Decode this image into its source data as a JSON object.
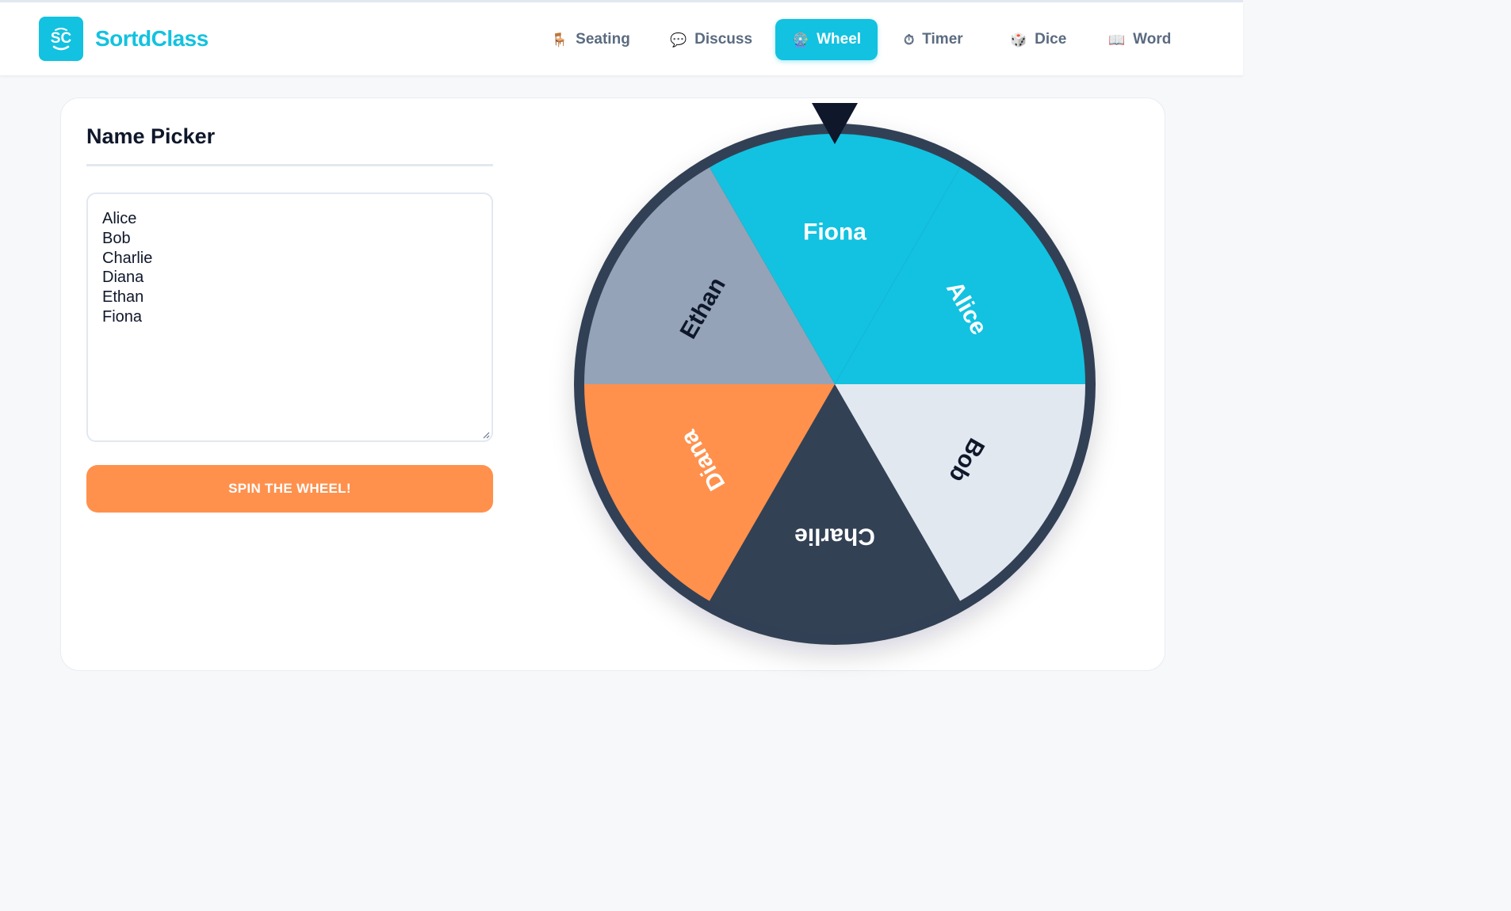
{
  "app": {
    "name": "SortdClass",
    "logo_mark": "SC",
    "brand_color": "#12c2e0"
  },
  "nav": [
    {
      "label": "Seating",
      "icon": "chair-icon",
      "glyph": "🪑",
      "active": false
    },
    {
      "label": "Discuss",
      "icon": "speech-bubble-icon",
      "glyph": "💬",
      "active": false
    },
    {
      "label": "Wheel",
      "icon": "ferris-wheel-icon",
      "glyph": "🎡",
      "active": true
    },
    {
      "label": "Timer",
      "icon": "stopwatch-icon",
      "glyph": "⏱",
      "active": false
    },
    {
      "label": "Dice",
      "icon": "dice-icon",
      "glyph": "🎲",
      "active": false
    },
    {
      "label": "Word",
      "icon": "book-icon",
      "glyph": "📖",
      "active": false
    }
  ],
  "picker": {
    "title": "Name Picker",
    "names": [
      "Alice",
      "Bob",
      "Charlie",
      "Diana",
      "Ethan",
      "Fiona"
    ],
    "spin_label": "SPIN THE WHEEL!"
  },
  "wheel": {
    "rim_color": "#334155",
    "pointer_color": "#0f172a",
    "segments": [
      {
        "name": "Alice",
        "color": "#12c2e0",
        "text_color": "#ffffff"
      },
      {
        "name": "Bob",
        "color": "#e2e8f0",
        "text_color": "#0f172a"
      },
      {
        "name": "Charlie",
        "color": "#334155",
        "text_color": "#ffffff"
      },
      {
        "name": "Diana",
        "color": "#ff914d",
        "text_color": "#ffffff"
      },
      {
        "name": "Ethan",
        "color": "#94a3b8",
        "text_color": "#0f172a"
      },
      {
        "name": "Fiona",
        "color": "#12c2e0",
        "text_color": "#ffffff"
      }
    ]
  }
}
